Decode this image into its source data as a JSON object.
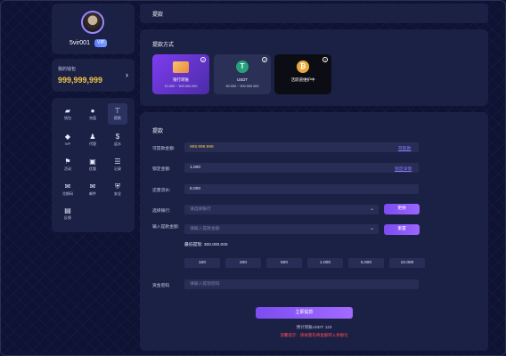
{
  "profile": {
    "username": "5vir001",
    "vip_badge": "VIP"
  },
  "balance": {
    "label": "我的钱包",
    "value": "999,999,999",
    "arrow": "›"
  },
  "menu": {
    "items": [
      {
        "label": "钱包",
        "icon": "wallet-icon",
        "glyph": "▰"
      },
      {
        "label": "充值",
        "icon": "deposit-icon",
        "glyph": "●"
      },
      {
        "label": "提款",
        "icon": "withdraw-icon",
        "glyph": "⊤"
      },
      {
        "label": "VIP",
        "icon": "diamond-icon",
        "glyph": "◆"
      },
      {
        "label": "代理",
        "icon": "agent-icon",
        "glyph": "♟"
      },
      {
        "label": "返水",
        "icon": "rebate-icon",
        "glyph": "$"
      },
      {
        "label": "活动",
        "icon": "activity-icon",
        "glyph": "⚑"
      },
      {
        "label": "优惠",
        "icon": "promo-icon",
        "glyph": "▣"
      },
      {
        "label": "记录",
        "icon": "record-icon",
        "glyph": "☰"
      },
      {
        "label": "兑换码",
        "icon": "redeem-icon",
        "glyph": "✉"
      },
      {
        "label": "邮件",
        "icon": "mail-icon",
        "glyph": "✉"
      },
      {
        "label": "安全",
        "icon": "shield-icon",
        "glyph": "⛨"
      },
      {
        "label": "反馈",
        "icon": "feedback-icon",
        "glyph": "▤"
      }
    ]
  },
  "header": {
    "title": "提款"
  },
  "methods": {
    "title": "提款方式",
    "cards": [
      {
        "name": "银行转账",
        "range": "10.000 ~ 300.000.000",
        "help": "?"
      },
      {
        "name": "USDT",
        "range": "50.000 ~ 300.000.000",
        "help": "?"
      },
      {
        "name": "活跃道维护中",
        "range": "",
        "help": "?"
      }
    ],
    "usdt_glyph": "T",
    "other_glyph": "₿"
  },
  "form": {
    "title": "提款",
    "available_label": "可提款金额:",
    "available_value": "999.999.999",
    "available_link": "存取款",
    "locked_label": "锁定金额:",
    "locked_value": "1.000",
    "locked_link": "锁定详情",
    "turnover_label": "还需流水:",
    "turnover_value": "8.000",
    "bank_label": "选择银行:",
    "bank_placeholder": "请选择银行",
    "bank_button": "更换",
    "amount_label": "输入提款金额:",
    "amount_placeholder": "请输入提款金额",
    "amount_button": "重置",
    "min_label": "最低提现: 300.000.000",
    "chips": [
      "100",
      "200",
      "500",
      "1.000",
      "5.000",
      "10.000"
    ],
    "password_label": "资金密码",
    "password_placeholder": "请输入提现密码",
    "submit": "立即提款",
    "estimate": "预计到账USDT: 123",
    "warning": "温馨提示：请按需先将金额转入余额包"
  },
  "colors": {
    "accent": "#8c5cff",
    "gold": "#f3c64a",
    "warning": "#ff4f5a"
  }
}
